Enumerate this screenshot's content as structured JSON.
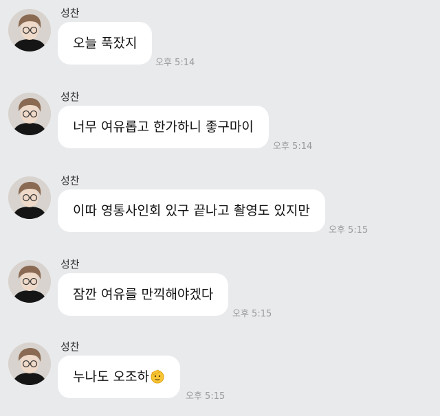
{
  "chat": {
    "messages": [
      {
        "sender": "성찬",
        "text": "오늘 푹잤지",
        "time": "오후 5:14"
      },
      {
        "sender": "성찬",
        "text": "너무 여유롭고 한가하니 좋구마이",
        "time": "오후 5:14"
      },
      {
        "sender": "성찬",
        "text": "이따 영통사인회 있구 끝나고 촬영도 있지만",
        "time": "오후 5:15"
      },
      {
        "sender": "성찬",
        "text": "잠깐 여유를 만끽해야겠다",
        "time": "오후 5:15"
      },
      {
        "sender": "성찬",
        "text": "누나도 오조하",
        "time": "오후 5:15",
        "emoji": "saluting-face-icon"
      }
    ]
  },
  "colors": {
    "background": "#e9eaec",
    "bubble": "#ffffff",
    "timestamp": "#9a9a9a"
  }
}
